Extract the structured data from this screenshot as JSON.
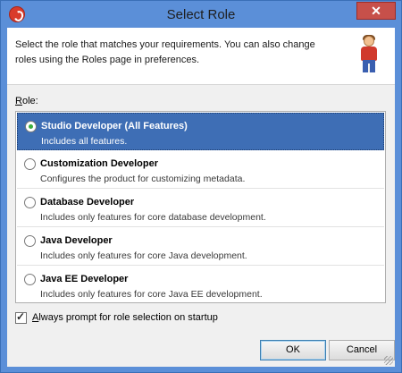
{
  "window": {
    "title": "Select Role",
    "close_label": "✕"
  },
  "header": {
    "intro_text": "Select the role that matches your requirements. You can also change roles using the Roles page in preferences."
  },
  "role_section": {
    "label_access_key": "R",
    "label_rest": "ole:"
  },
  "roles": [
    {
      "title": "Studio Developer (All Features)",
      "description": "Includes all features.",
      "selected": true
    },
    {
      "title": "Customization Developer",
      "description": "Configures the product for customizing metadata.",
      "selected": false
    },
    {
      "title": "Database Developer",
      "description": "Includes only features for core database development.",
      "selected": false
    },
    {
      "title": "Java Developer",
      "description": "Includes only features for core Java development.",
      "selected": false
    },
    {
      "title": "Java EE Developer",
      "description": "Includes only features for core Java EE development.",
      "selected": false
    }
  ],
  "always_prompt": {
    "checked": true,
    "label_access_key": "A",
    "label_rest": "lways prompt for role selection on startup"
  },
  "buttons": {
    "ok": "OK",
    "cancel": "Cancel"
  },
  "colors": {
    "titlebar": "#5b8fd8",
    "selection": "#3e6eb5",
    "radio_checked": "#3cae3c"
  }
}
